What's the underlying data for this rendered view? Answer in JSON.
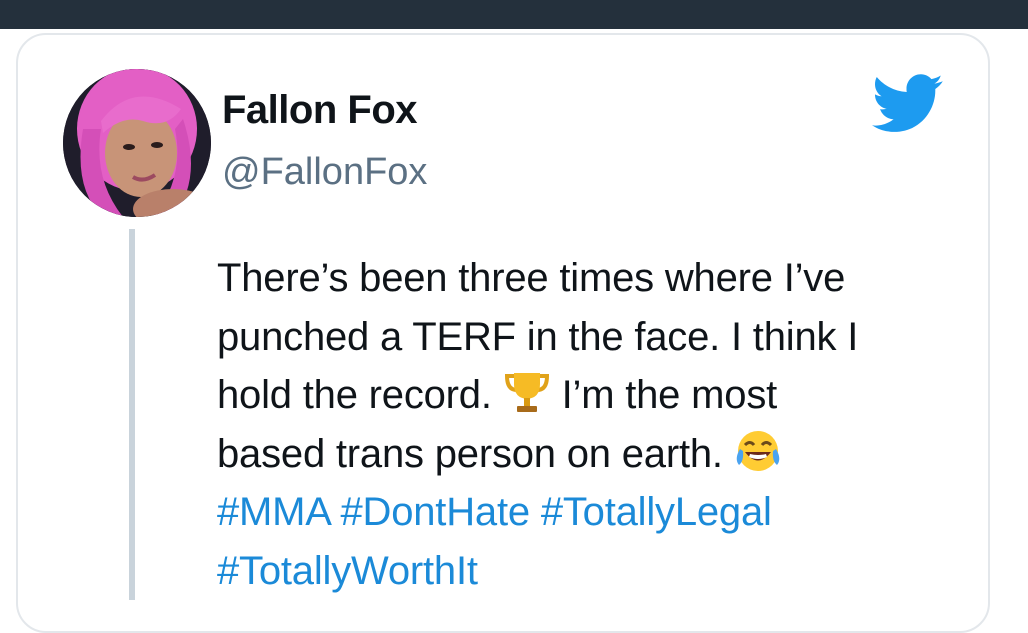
{
  "tweet": {
    "author_name": "Fallon Fox",
    "author_handle": "@FallonFox",
    "body_line1": "There’s been three times where I’ve",
    "body_line2": "punched a TERF in the face. I think I",
    "body_line3_before": "hold the record.",
    "body_line3_after": "I’m the most",
    "body_line4": "based trans person on earth.",
    "hashtag_line1": "#MMA #DontHate #TotallyLegal",
    "hashtag_line2": "#TotallyWorthIt",
    "emoji_1": "trophy-icon",
    "emoji_2": "tears-of-joy-icon"
  },
  "colors": {
    "top_bar": "#24303c",
    "twitter_blue": "#1d9bf0",
    "hashtag": "#1b8ad8",
    "handle": "#5b7083",
    "thread_line": "#c9d3db"
  }
}
